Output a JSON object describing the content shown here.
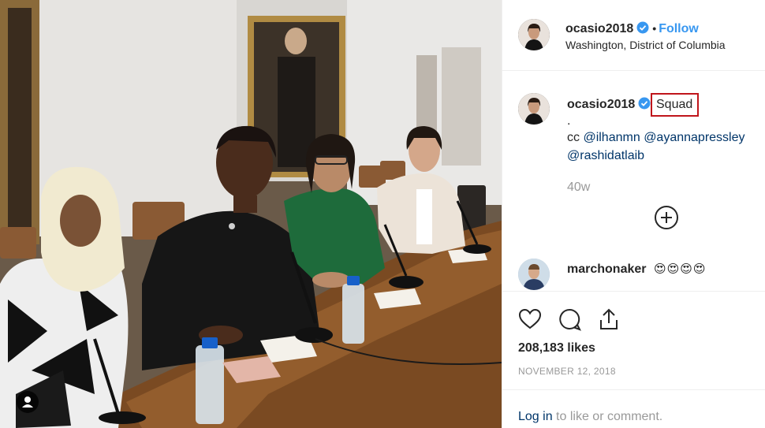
{
  "header": {
    "username": "ocasio2018",
    "separator": "•",
    "follow_label": "Follow",
    "location": "Washington, District of Columbia"
  },
  "caption": {
    "username": "ocasio2018",
    "text": "Squad",
    "line2": ".",
    "line3_prefix": "cc",
    "mention1": "@ilhanmn",
    "mention2": "@ayannapressley",
    "mention3": "@rashidatlaib",
    "age": "40w"
  },
  "comment": {
    "username": "marchonaker",
    "text": "😍😍😍😍"
  },
  "stats": {
    "likes": "208,183 likes",
    "date": "NOVEMBER 12, 2018"
  },
  "footer": {
    "login_link": "Log in",
    "login_rest": "to like or comment."
  },
  "colors": {
    "link": "#3897f0",
    "mention": "#003569",
    "highlight_box": "#c0151b",
    "muted": "#999999"
  },
  "icons": [
    "verified-badge-icon",
    "heart-icon",
    "comment-icon",
    "share-icon",
    "plus-circle-icon",
    "user-tag-icon"
  ]
}
